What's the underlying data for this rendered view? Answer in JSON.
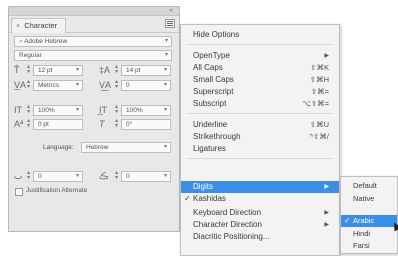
{
  "panel": {
    "tab_label": "Character",
    "tab_close": "×",
    "collapse_glyph": "«",
    "font_family": "Adobe Hebrew",
    "font_style": "Regular",
    "font_size": "12 pt",
    "leading": "14 pt",
    "kerning": "Metrics",
    "tracking": "0",
    "vertical_scale": "100%",
    "horizontal_scale": "100%",
    "baseline_shift": "0 pt",
    "skew": "0°",
    "language_label": "Language:",
    "language_value": "Hebrew",
    "justification_label": "Justification Alternate",
    "bottom_left_value": "0",
    "bottom_right_value": "0",
    "icons": {
      "font_size": "font-size-icon",
      "leading": "leading-icon",
      "kerning": "kerning-icon",
      "tracking": "tracking-icon",
      "vertical_scale": "vertical-scale-icon",
      "horizontal_scale": "horizontal-scale-icon",
      "baseline_shift": "baseline-shift-icon",
      "skew": "skew-icon"
    }
  },
  "menu": {
    "items": [
      {
        "label": "Hide Options",
        "shortcut": "",
        "arrow": false,
        "checked": false,
        "disabled": false,
        "highlighted": false
      },
      {
        "label": "OpenType",
        "shortcut": "",
        "arrow": true,
        "checked": false,
        "disabled": false,
        "highlighted": false
      },
      {
        "label": "All Caps",
        "shortcut": "⇧⌘K",
        "arrow": false,
        "checked": false,
        "disabled": false,
        "highlighted": false
      },
      {
        "label": "Small Caps",
        "shortcut": "⇧⌘H",
        "arrow": false,
        "checked": false,
        "disabled": false,
        "highlighted": false
      },
      {
        "label": "Superscript",
        "shortcut": "⇧⌘=",
        "arrow": false,
        "checked": false,
        "disabled": false,
        "highlighted": false
      },
      {
        "label": "Subscript",
        "shortcut": "⌥⇧⌘=",
        "arrow": false,
        "checked": false,
        "disabled": false,
        "highlighted": false
      },
      {
        "label": "Underline",
        "shortcut": "⇧⌘U",
        "arrow": false,
        "checked": false,
        "disabled": false,
        "highlighted": false
      },
      {
        "label": "Strikethrough",
        "shortcut": "^⇧⌘/",
        "arrow": false,
        "checked": false,
        "disabled": false,
        "highlighted": false
      },
      {
        "label": "Ligatures",
        "shortcut": "",
        "arrow": false,
        "checked": false,
        "disabled": false,
        "highlighted": false
      },
      {
        "label": "Digits",
        "shortcut": "",
        "arrow": true,
        "checked": false,
        "disabled": false,
        "highlighted": true
      },
      {
        "label": "Kashidas",
        "shortcut": "",
        "arrow": false,
        "checked": true,
        "disabled": false,
        "highlighted": false
      },
      {
        "label": "Keyboard Direction",
        "shortcut": "",
        "arrow": true,
        "checked": false,
        "disabled": false,
        "highlighted": false
      },
      {
        "label": "Character Direction",
        "shortcut": "",
        "arrow": true,
        "checked": false,
        "disabled": false,
        "highlighted": false
      },
      {
        "label": "Diacritic Positioning...",
        "shortcut": "",
        "arrow": false,
        "checked": false,
        "disabled": false,
        "highlighted": false
      }
    ],
    "check_glyph": "✓",
    "arrow_glyph": "▶"
  },
  "submenu": {
    "items": [
      {
        "label": "Default",
        "checked": false,
        "highlighted": false
      },
      {
        "label": "Native",
        "checked": false,
        "highlighted": false
      },
      {
        "label": "Arabic",
        "checked": true,
        "highlighted": true
      },
      {
        "label": "Hindi",
        "checked": false,
        "highlighted": false
      },
      {
        "label": "Farsi",
        "checked": false,
        "highlighted": false
      }
    ]
  },
  "colors": {
    "highlight": "#3d8ee6",
    "menu_bg": "#f3f3f3",
    "panel_bg": "#e8e8e8"
  }
}
